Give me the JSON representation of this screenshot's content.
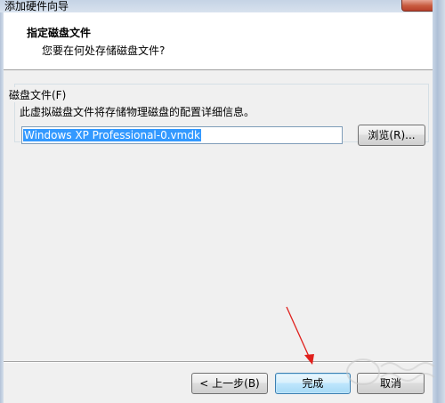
{
  "window": {
    "title": "添加硬件向导"
  },
  "header": {
    "title": "指定磁盘文件",
    "subtitle": "您要在何处存储磁盘文件?"
  },
  "disk_file_group": {
    "label": "磁盘文件(F)",
    "description": "此虚拟磁盘文件将存储物理磁盘的配置详细信息。",
    "file_value": "Windows XP Professional-0.vmdk",
    "browse_label": "浏览(R)..."
  },
  "footer": {
    "back_label": "< 上一步(B)",
    "finish_label": "完成",
    "cancel_label": "取消"
  },
  "annotation": {
    "arrow_color": "#e0201c"
  }
}
